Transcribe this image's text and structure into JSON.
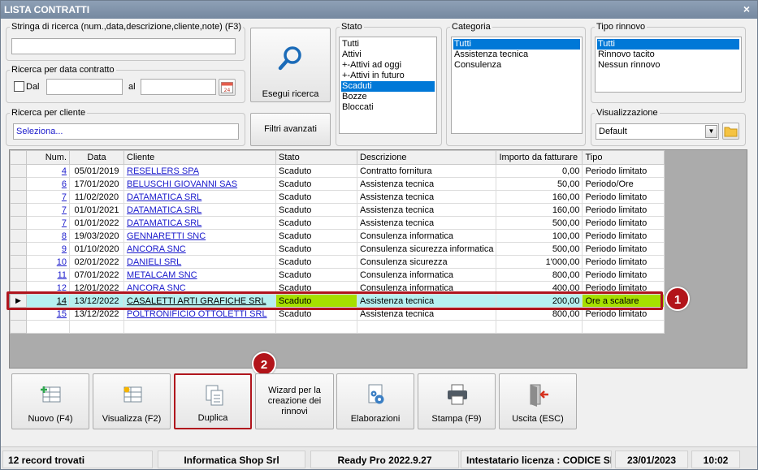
{
  "window": {
    "title": "LISTA CONTRATTI",
    "close": "×"
  },
  "search": {
    "label": "Stringa di ricerca (num.,data,descrizione,cliente,note) (F3)",
    "value": ""
  },
  "date_search": {
    "label": "Ricerca per data contratto",
    "from_label": "Dal",
    "to_label": "al",
    "from": "",
    "to": ""
  },
  "client_search": {
    "label": "Ricerca per cliente",
    "value": "Seleziona..."
  },
  "buttons": {
    "search": "Esegui ricerca",
    "advanced": "Filtri avanzati"
  },
  "stato": {
    "label": "Stato",
    "items": [
      "Tutti",
      "Attivi",
      "+-Attivi ad oggi",
      "+-Attivi in futuro",
      "Scaduti",
      "Bozze",
      "Bloccati"
    ],
    "selected": 4
  },
  "categoria": {
    "label": "Categoria",
    "items": [
      "Tutti",
      "Assistenza tecnica",
      "Consulenza"
    ],
    "selected": 0
  },
  "tipo_rinnovo": {
    "label": "Tipo rinnovo",
    "items": [
      "Tutti",
      "Rinnovo tacito",
      "Nessun rinnovo"
    ],
    "selected": 0
  },
  "visualizzazione": {
    "label": "Visualizzazione",
    "value": "Default"
  },
  "table": {
    "columns": [
      "Num.",
      "Data",
      "Cliente",
      "Stato",
      "Descrizione",
      "Importo da fatturare",
      "Tipo"
    ],
    "rows": [
      [
        "4",
        "05/01/2019",
        "RESELLERS SPA",
        "Scaduto",
        "Contratto fornitura",
        "0,00",
        "Periodo limitato"
      ],
      [
        "6",
        "17/01/2020",
        "BELUSCHI GIOVANNI SAS",
        "Scaduto",
        "Assistenza tecnica",
        "50,00",
        "Periodo/Ore"
      ],
      [
        "7",
        "11/02/2020",
        "DATAMATICA SRL",
        "Scaduto",
        "Assistenza tecnica",
        "160,00",
        "Periodo limitato"
      ],
      [
        "7",
        "01/01/2021",
        "DATAMATICA SRL",
        "Scaduto",
        "Assistenza tecnica",
        "160,00",
        "Periodo limitato"
      ],
      [
        "7",
        "01/01/2022",
        "DATAMATICA SRL",
        "Scaduto",
        "Assistenza tecnica",
        "500,00",
        "Periodo limitato"
      ],
      [
        "8",
        "19/03/2020",
        "GENNARETTI SNC",
        "Scaduto",
        "Consulenza informatica",
        "100,00",
        "Periodo limitato"
      ],
      [
        "9",
        "01/10/2020",
        "ANCORA SNC",
        "Scaduto",
        "Consulenza sicurezza informatica",
        "500,00",
        "Periodo limitato"
      ],
      [
        "10",
        "02/01/2022",
        "DANIELI SRL",
        "Scaduto",
        "Consulenza sicurezza",
        "1'000,00",
        "Periodo limitato"
      ],
      [
        "11",
        "07/01/2022",
        "METALCAM SNC",
        "Scaduto",
        "Consulenza informatica",
        "800,00",
        "Periodo limitato"
      ],
      [
        "12",
        "12/01/2022",
        "ANCORA SNC",
        "Scaduto",
        "Consulenza informatica",
        "400,00",
        "Periodo limitato"
      ],
      [
        "14",
        "13/12/2022",
        "CASALETTI ARTI GRAFICHE SRL",
        "Scaduto",
        "Assistenza tecnica",
        "200,00",
        "Ore a scalare"
      ],
      [
        "15",
        "13/12/2022",
        "POLTRONIFICIO OTTOLETTI SRL",
        "Scaduto",
        "Assistenza tecnica",
        "800,00",
        "Periodo limitato"
      ]
    ],
    "selected_row": 10
  },
  "callouts": [
    "1",
    "2"
  ],
  "toolbar": {
    "nuovo": "Nuovo (F4)",
    "visualizza": "Visualizza (F2)",
    "duplica": "Duplica",
    "wizard": "Wizard per la creazione dei rinnovi",
    "elaborazioni": "Elaborazioni",
    "stampa": "Stampa (F9)",
    "uscita": "Uscita (ESC)"
  },
  "status": {
    "records": "12 record trovati",
    "company": "Informatica Shop Srl",
    "version": "Ready Pro 2022.9.27",
    "license": "Intestatario licenza : CODICE SR",
    "date": "23/01/2023",
    "time": "10:02"
  },
  "colors": {
    "accent": "#0078d7",
    "highlight_row": "#b6f0f0",
    "highlight_green": "#a5e000",
    "callout": "#b2141a"
  }
}
